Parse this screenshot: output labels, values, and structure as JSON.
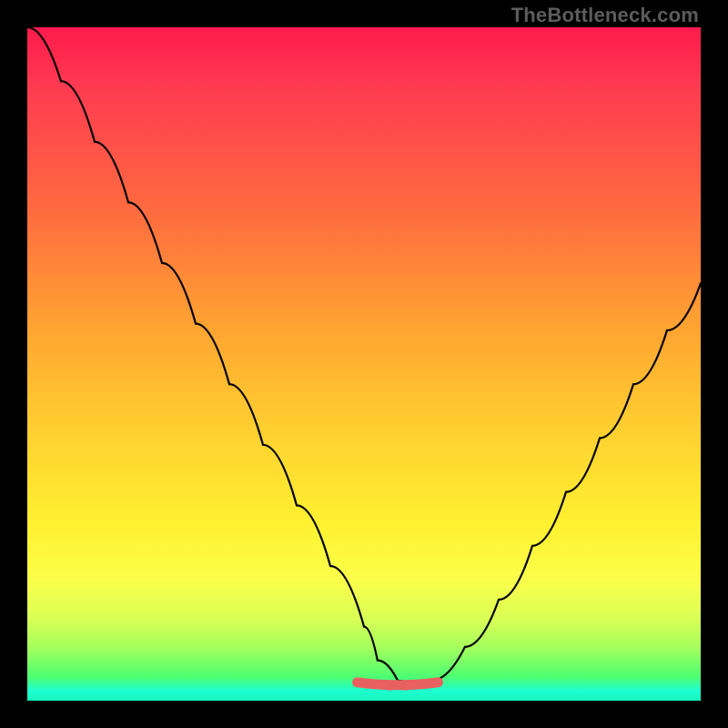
{
  "watermark": "TheBottleneck.com",
  "colors": {
    "frame_background": "#000000",
    "watermark_text": "#5c5c5c",
    "curve_stroke": "#000000",
    "flat_highlight": "#e86060",
    "gradient_top": "#ff1a4b",
    "gradient_mid": "#ffd030",
    "gradient_bottom": "#17f5c0"
  },
  "chart_data": {
    "type": "line",
    "title": "",
    "xlabel": "",
    "ylabel": "",
    "xlim": [
      0,
      100
    ],
    "ylim": [
      0,
      100
    ],
    "grid": false,
    "legend": false,
    "description": "V-shaped bottleneck curve: high (bad) at both extremes, minimum (good) around the center-right. Background gradient maps y: red=high, green=low.",
    "series": [
      {
        "name": "bottleneck",
        "x": [
          0,
          5,
          10,
          15,
          20,
          25,
          30,
          35,
          40,
          45,
          50,
          52,
          55,
          58,
          60,
          65,
          70,
          75,
          80,
          85,
          90,
          95,
          100
        ],
        "values": [
          100,
          92,
          83,
          74,
          65,
          56,
          47,
          38,
          29,
          20,
          11,
          6,
          3,
          2,
          3,
          8,
          15,
          23,
          31,
          39,
          47,
          55,
          62
        ]
      }
    ],
    "highlight_flat_region": {
      "x_start": 49,
      "x_end": 61,
      "y": 3
    }
  }
}
